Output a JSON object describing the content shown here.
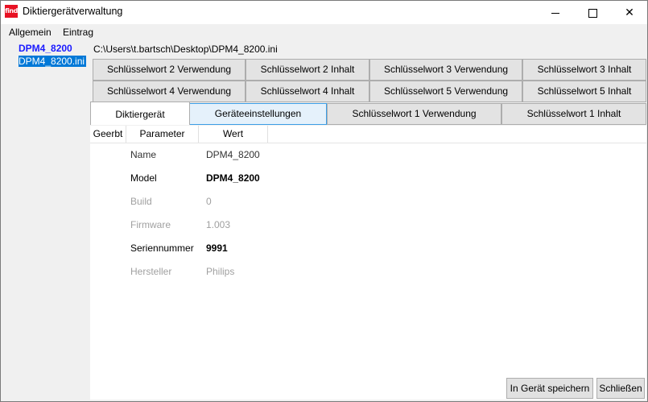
{
  "window": {
    "app_icon_text": "find",
    "title": "Diktiergerätverwaltung",
    "minimize_icon": "minimize-icon",
    "maximize_icon": "maximize-icon",
    "close_symbol": "✕"
  },
  "menu": {
    "items": [
      "Allgemein",
      "Eintrag"
    ]
  },
  "tree": {
    "root": "DPM4_8200",
    "child": "DPM4_8200.ini"
  },
  "path": "C:\\Users\\t.bartsch\\Desktop\\DPM4_8200.ini",
  "tabs": {
    "row1": [
      "Schlüsselwort 2 Verwendung",
      "Schlüsselwort 2 Inhalt",
      "Schlüsselwort 3 Verwendung",
      "Schlüsselwort 3 Inhalt"
    ],
    "row2": [
      "Schlüsselwort 4 Verwendung",
      "Schlüsselwort 4 Inhalt",
      "Schlüsselwort 5 Verwendung",
      "Schlüsselwort 5 Inhalt"
    ],
    "row3": [
      "Diktiergerät",
      "Geräteeinstellungen",
      "Schlüsselwort 1 Verwendung",
      "Schlüsselwort 1 Inhalt"
    ],
    "active": "Diktiergerät"
  },
  "table": {
    "headers": [
      "Geerbt",
      "Parameter",
      "Wert"
    ],
    "rows": [
      {
        "label": "Name",
        "value": "DPM4_8200"
      },
      {
        "label": "Model",
        "value": "DPM4_8200"
      },
      {
        "label": "Build",
        "value": "0"
      },
      {
        "label": "Firmware",
        "value": "1.003"
      },
      {
        "label": "Seriennummer",
        "value": "9991"
      },
      {
        "label": "Hersteller",
        "value": "Philips"
      }
    ]
  },
  "buttons": {
    "save": "In Gerät speichern",
    "close": "Schließen"
  },
  "colors": {
    "accent": "#0078d7",
    "tree_link": "#1a1aff",
    "close_red": "#e81123"
  }
}
